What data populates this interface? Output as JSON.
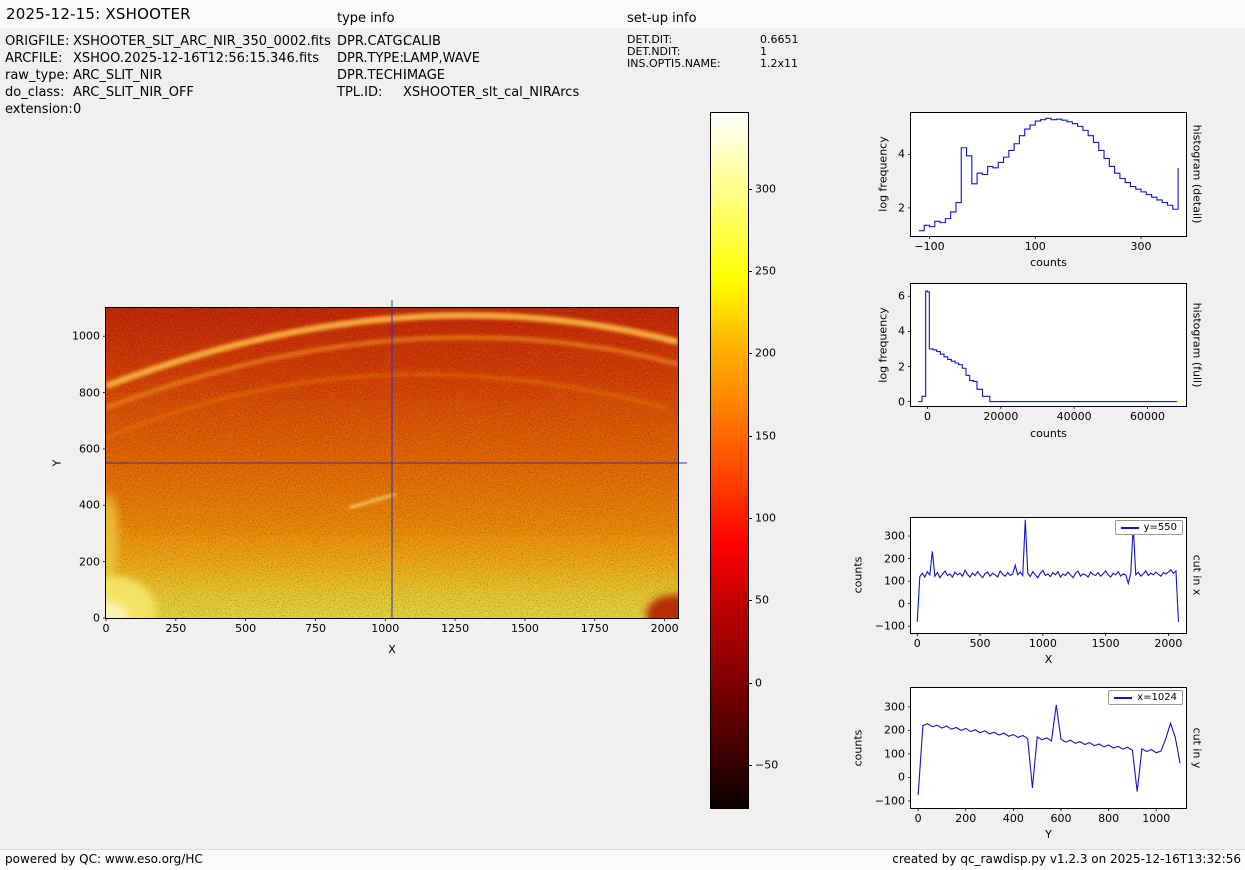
{
  "header": {
    "title": "2025-12-15: XSHOOTER",
    "file_info": [
      {
        "label": "ORIGFILE:",
        "value": "XSHOOTER_SLT_ARC_NIR_350_0002.fits"
      },
      {
        "label": "ARCFILE:",
        "value": "XSHOO.2025-12-16T12:56:15.346.fits"
      },
      {
        "label": "raw_type:",
        "value": "ARC_SLIT_NIR"
      },
      {
        "label": "do_class:",
        "value": "ARC_SLIT_NIR_OFF"
      },
      {
        "label": "extension:",
        "value": "0"
      }
    ],
    "type_info": {
      "title": "type info",
      "rows": [
        {
          "label": "DPR.CATG:",
          "value": "CALIB"
        },
        {
          "label": "DPR.TYPE:",
          "value": "LAMP,WAVE"
        },
        {
          "label": "DPR.TECH:",
          "value": "IMAGE"
        },
        {
          "label": "TPL.ID:",
          "value": "XSHOOTER_slt_cal_NIRArcs"
        }
      ]
    },
    "setup_info": {
      "title": "set-up info",
      "rows": [
        {
          "label": "DET.DIT:",
          "value": "0.6651"
        },
        {
          "label": "DET.NDIT:",
          "value": "1"
        },
        {
          "label": "INS.OPTI5.NAME:",
          "value": "1.2x11"
        }
      ]
    }
  },
  "footer": {
    "left": "powered by QC: www.eso.org/HC",
    "right": "created by qc_rawdisp.py v1.2.3 on 2025-12-16T13:32:56"
  },
  "chart_data": [
    {
      "id": "detector-image",
      "type": "heatmap",
      "xlabel": "X",
      "ylabel": "Y",
      "xlim": [
        0,
        2048
      ],
      "ylim": [
        0,
        1100
      ],
      "xticks": [
        0,
        250,
        500,
        750,
        1000,
        1250,
        1500,
        1750,
        2000
      ],
      "yticks": [
        0,
        200,
        400,
        600,
        800,
        1000
      ],
      "colormap": "hot",
      "crosshair": {
        "x": 1024,
        "y": 550,
        "color": "#2233bb"
      },
      "description": "XSHOOTER NIR arc-lamp raw frame: bright yellow at bottom grading to red at top, bright curved spectral-order arcs near the top, bright blob in bottom-left corner, dark red patch in bottom-right corner"
    },
    {
      "id": "colorbar",
      "type": "colorbar",
      "colormap": "hot",
      "vmin": -76,
      "vmax": 346,
      "ticks": [
        300,
        250,
        200,
        150,
        100,
        50,
        0,
        -50
      ]
    },
    {
      "id": "hist-detail",
      "type": "line",
      "style": "step",
      "color": "#1414cc",
      "side_label": "histogram (detail)",
      "xlabel": "counts",
      "ylabel": "log frequency",
      "xlim": [
        -135,
        385
      ],
      "ylim": [
        0.95,
        5.55
      ],
      "xticks": [
        -100,
        100,
        300
      ],
      "yticks": [
        2,
        4
      ],
      "x": [
        -120,
        -110,
        -100,
        -90,
        -80,
        -70,
        -60,
        -50,
        -40,
        -30,
        -20,
        -10,
        0,
        10,
        20,
        30,
        40,
        50,
        60,
        70,
        80,
        90,
        100,
        110,
        120,
        130,
        140,
        150,
        160,
        170,
        180,
        190,
        200,
        210,
        220,
        230,
        240,
        250,
        260,
        270,
        280,
        290,
        300,
        310,
        320,
        330,
        340,
        350,
        360,
        370
      ],
      "y": [
        1.15,
        1.35,
        1.3,
        1.5,
        1.45,
        1.6,
        1.85,
        2.2,
        4.25,
        3.95,
        2.9,
        3.3,
        3.25,
        3.55,
        3.5,
        3.7,
        3.9,
        4.15,
        4.4,
        4.7,
        4.95,
        5.1,
        5.25,
        5.3,
        5.35,
        5.3,
        5.32,
        5.28,
        5.22,
        5.15,
        5.05,
        4.9,
        4.7,
        4.45,
        4.15,
        3.85,
        3.55,
        3.3,
        3.1,
        2.95,
        2.8,
        2.7,
        2.6,
        2.5,
        2.4,
        2.3,
        2.2,
        2.1,
        1.95,
        3.5
      ]
    },
    {
      "id": "hist-full",
      "type": "line",
      "style": "step",
      "color": "#1414cc",
      "side_label": "histogram (full)",
      "xlabel": "counts",
      "ylabel": "log frequency",
      "xlim": [
        -4500,
        70500
      ],
      "ylim": [
        -0.25,
        6.7
      ],
      "xticks": [
        0,
        20000,
        40000,
        60000
      ],
      "yticks": [
        0,
        2,
        4,
        6
      ],
      "x": [
        -2500,
        -1500,
        -500,
        0,
        500,
        1500,
        2500,
        3500,
        4500,
        5500,
        6500,
        7500,
        8500,
        9500,
        10500,
        11500,
        12500,
        13500,
        15000,
        17000,
        19000,
        25000,
        40000,
        68000
      ],
      "y": [
        0,
        0.3,
        6.3,
        6.25,
        3.0,
        2.95,
        2.85,
        2.7,
        2.55,
        2.4,
        2.3,
        2.2,
        2.1,
        1.9,
        1.5,
        1.2,
        1.15,
        0.7,
        0.3,
        0,
        0,
        0,
        0,
        0
      ]
    },
    {
      "id": "cut-x",
      "type": "line",
      "style": "line",
      "color": "#1414cc",
      "legend": "y=550",
      "side_label": "cut in x",
      "xlabel": "X",
      "ylabel": "counts",
      "xlim": [
        -50,
        2140
      ],
      "ylim": [
        -130,
        380
      ],
      "xticks": [
        0,
        500,
        1000,
        1500,
        2000
      ],
      "yticks": [
        -100,
        0,
        100,
        200,
        300
      ],
      "x0": 0,
      "dx": 20,
      "y": [
        -80,
        120,
        135,
        118,
        142,
        128,
        232,
        122,
        138,
        115,
        130,
        145,
        125,
        132,
        118,
        140,
        128,
        135,
        122,
        148,
        130,
        118,
        136,
        125,
        142,
        128,
        115,
        133,
        140,
        122,
        135,
        128,
        118,
        145,
        130,
        122,
        138,
        125,
        132,
        170,
        128,
        140,
        125,
        372,
        135,
        120,
        142,
        128,
        115,
        135,
        148,
        125,
        132,
        120,
        138,
        128,
        142,
        118,
        132,
        125,
        140,
        128,
        115,
        135,
        145,
        122,
        132,
        128,
        118,
        140,
        130,
        125,
        138,
        122,
        132,
        145,
        128,
        118,
        135,
        128,
        142,
        122,
        132,
        128,
        90,
        135,
        345,
        128,
        140,
        122,
        132,
        145,
        125,
        135,
        128,
        140,
        130,
        122,
        138,
        132,
        140,
        150,
        135,
        145,
        -80
      ]
    },
    {
      "id": "cut-y",
      "type": "line",
      "style": "line",
      "color": "#1414cc",
      "legend": "x=1024",
      "side_label": "cut in y",
      "xlabel": "Y",
      "ylabel": "counts",
      "xlim": [
        -30,
        1125
      ],
      "ylim": [
        -130,
        380
      ],
      "xticks": [
        0,
        200,
        400,
        600,
        800,
        1000
      ],
      "yticks": [
        -100,
        0,
        100,
        200,
        300
      ],
      "x0": 0,
      "dx": 20,
      "y": [
        -75,
        220,
        228,
        215,
        222,
        210,
        218,
        205,
        212,
        200,
        208,
        195,
        202,
        190,
        198,
        185,
        192,
        180,
        188,
        175,
        182,
        170,
        178,
        165,
        -45,
        172,
        160,
        168,
        155,
        308,
        162,
        150,
        158,
        145,
        152,
        140,
        148,
        135,
        142,
        130,
        138,
        125,
        132,
        120,
        128,
        115,
        -60,
        122,
        110,
        118,
        105,
        112,
        165,
        230,
        170,
        60
      ]
    }
  ]
}
